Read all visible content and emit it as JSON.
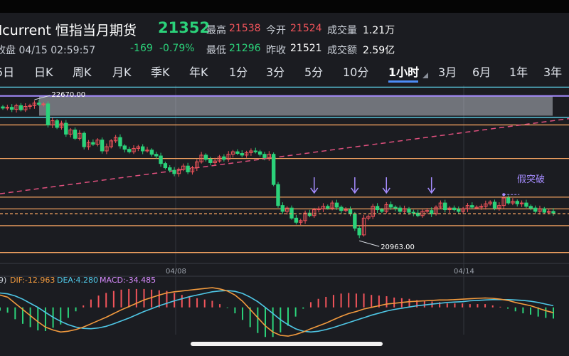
{
  "header": {
    "title": "lcurrent 恒指当月期货",
    "price": "21352",
    "sub_left": "收盘 04/15 02:59:57",
    "change": "-169",
    "change_pct": "-0.79%",
    "high_label": "最高",
    "high_value": "21538",
    "low_label": "最低",
    "low_value": "21296",
    "open_label": "今开",
    "open_value": "21524",
    "prev_label": "昨收",
    "prev_value": "21521",
    "vol_label": "成交量",
    "vol_value": "1.21万",
    "amt_label": "成交额",
    "amt_value": "2.59亿"
  },
  "tabs": [
    {
      "label": "5日"
    },
    {
      "label": "日K"
    },
    {
      "label": "周K"
    },
    {
      "label": "月K"
    },
    {
      "label": "季K"
    },
    {
      "label": "年K"
    },
    {
      "label": "1分"
    },
    {
      "label": "3分"
    },
    {
      "label": "5分"
    },
    {
      "label": "10分"
    },
    {
      "label": "1小时",
      "active": true
    },
    {
      "label": "3月"
    },
    {
      "label": "6月"
    },
    {
      "label": "1年"
    },
    {
      "label": "3年"
    }
  ],
  "colors": {
    "up": "#f2545b",
    "down": "#2bd27a",
    "cyan": "#5fd6ee",
    "orange": "#f0a060",
    "pink": "#e0507e",
    "purple": "#a58cff",
    "dif": "#f29a3e",
    "dea": "#4fc7e6"
  },
  "chart_data": [
    {
      "type": "candlestick",
      "ylim": [
        20760,
        22880
      ],
      "x_ticks": [
        "04/08",
        "04/14"
      ],
      "annotations": [
        {
          "text": "22670.00",
          "kind": "max"
        },
        {
          "text": "20963.00",
          "kind": "min"
        },
        {
          "text": "假突破",
          "kind": "label"
        }
      ],
      "horizontal_lines": [
        {
          "value": 22860,
          "color": "cyan"
        },
        {
          "value": 22500,
          "color": "cyan"
        },
        {
          "value": 22410,
          "color": "orange"
        },
        {
          "value": 22010,
          "color": "orange"
        },
        {
          "value": 21550,
          "color": "orange"
        },
        {
          "value": 21410,
          "color": "orange"
        },
        {
          "value": 21210,
          "color": "orange"
        },
        {
          "value": 20890,
          "color": "orange"
        }
      ],
      "zones": [
        {
          "from": 22755,
          "to": 22520,
          "color": "purple"
        }
      ],
      "dashed_lines": [
        {
          "value": 21352,
          "label": "last price"
        }
      ],
      "trend_line": {
        "start": 21590,
        "end": 22485
      },
      "series": [
        {
          "values": [
            22610,
            22620,
            22595,
            22640,
            22590,
            22630,
            22640,
            22670,
            22655,
            22660,
            22410,
            22460,
            22380,
            22430,
            22300,
            22350,
            22250,
            22310,
            22150,
            22200,
            22180,
            22230,
            22100,
            22150,
            22220,
            22260,
            22160,
            22120,
            22090,
            22130,
            22150,
            22100,
            22110,
            22060,
            22040,
            21950,
            21900,
            21870,
            21830,
            21880,
            21920,
            21850,
            21900,
            21970,
            22050,
            22000,
            21960,
            21980,
            22030,
            22000,
            22060,
            22090,
            22070,
            22050,
            22080,
            22100,
            22090,
            22060,
            22020,
            22060,
            21700,
            21450,
            21380,
            21420,
            21300,
            21250,
            21270,
            21360,
            21330,
            21400,
            21410,
            21440,
            21420,
            21480,
            21430,
            21390,
            21400,
            21350,
            21180,
            21100,
            21300,
            21320,
            21440,
            21400,
            21380,
            21460,
            21430,
            21420,
            21380,
            21410,
            21370,
            21360,
            21330,
            21380,
            21390,
            21350,
            21430,
            21480,
            21400,
            21420,
            21400,
            21380,
            21410,
            21450,
            21430,
            21430,
            21440,
            21470,
            21490,
            21420,
            21450,
            21540,
            21480,
            21500,
            21470,
            21480,
            21440,
            21420,
            21380,
            21410,
            21370,
            21380,
            21360
          ]
        }
      ],
      "markers": [
        21600,
        21600,
        21600,
        21600
      ]
    },
    {
      "type": "macd",
      "legend": {
        "prefix": "9)",
        "dif": "DIF:-12.963",
        "dea": "DEA:4.280",
        "macd": "MACD:-34.485"
      },
      "dif": [
        30,
        25,
        10,
        -5,
        -20,
        -35,
        -48,
        -55,
        -60,
        -58,
        -54,
        -48,
        -40,
        -32,
        -24,
        -15,
        -6,
        2,
        10,
        18,
        24,
        30,
        35,
        38,
        40,
        42,
        44,
        46,
        48,
        45,
        40,
        30,
        15,
        -5,
        -25,
        -45,
        -60,
        -68,
        -70,
        -66,
        -60,
        -52,
        -45,
        -38,
        -30,
        -22,
        -15,
        -10,
        -4,
        0,
        4,
        8,
        10,
        12,
        14,
        15,
        16,
        17,
        18,
        18,
        19,
        20,
        21,
        22,
        23,
        22,
        20,
        17,
        12,
        8,
        4,
        -2,
        -8,
        -13
      ],
      "dea": [
        35,
        33,
        28,
        20,
        10,
        0,
        -12,
        -24,
        -34,
        -42,
        -48,
        -51,
        -52,
        -50,
        -46,
        -40,
        -33,
        -26,
        -18,
        -10,
        -3,
        4,
        10,
        16,
        21,
        26,
        30,
        34,
        38,
        40,
        41,
        39,
        34,
        25,
        14,
        0,
        -15,
        -30,
        -42,
        -52,
        -58,
        -60,
        -58,
        -54,
        -49,
        -43,
        -37,
        -31,
        -25,
        -19,
        -14,
        -9,
        -5,
        -2,
        1,
        4,
        6,
        8,
        10,
        12,
        13,
        14,
        16,
        17,
        18,
        19,
        19,
        19,
        18,
        17,
        15,
        12,
        8,
        4
      ],
      "ylim": [
        -75,
        55
      ]
    }
  ]
}
